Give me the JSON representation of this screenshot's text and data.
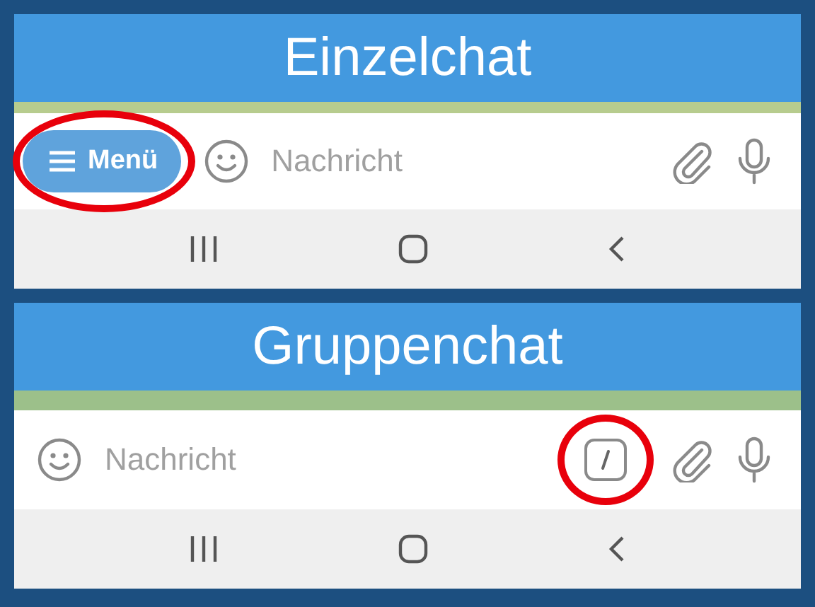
{
  "panels": [
    {
      "title": "Einzelchat",
      "menu_button": {
        "label": "Menü",
        "highlighted": true
      },
      "placeholder": "Nachricht"
    },
    {
      "title": "Gruppenchat",
      "placeholder": "Nachricht",
      "command_button": {
        "highlighted": true
      }
    }
  ]
}
